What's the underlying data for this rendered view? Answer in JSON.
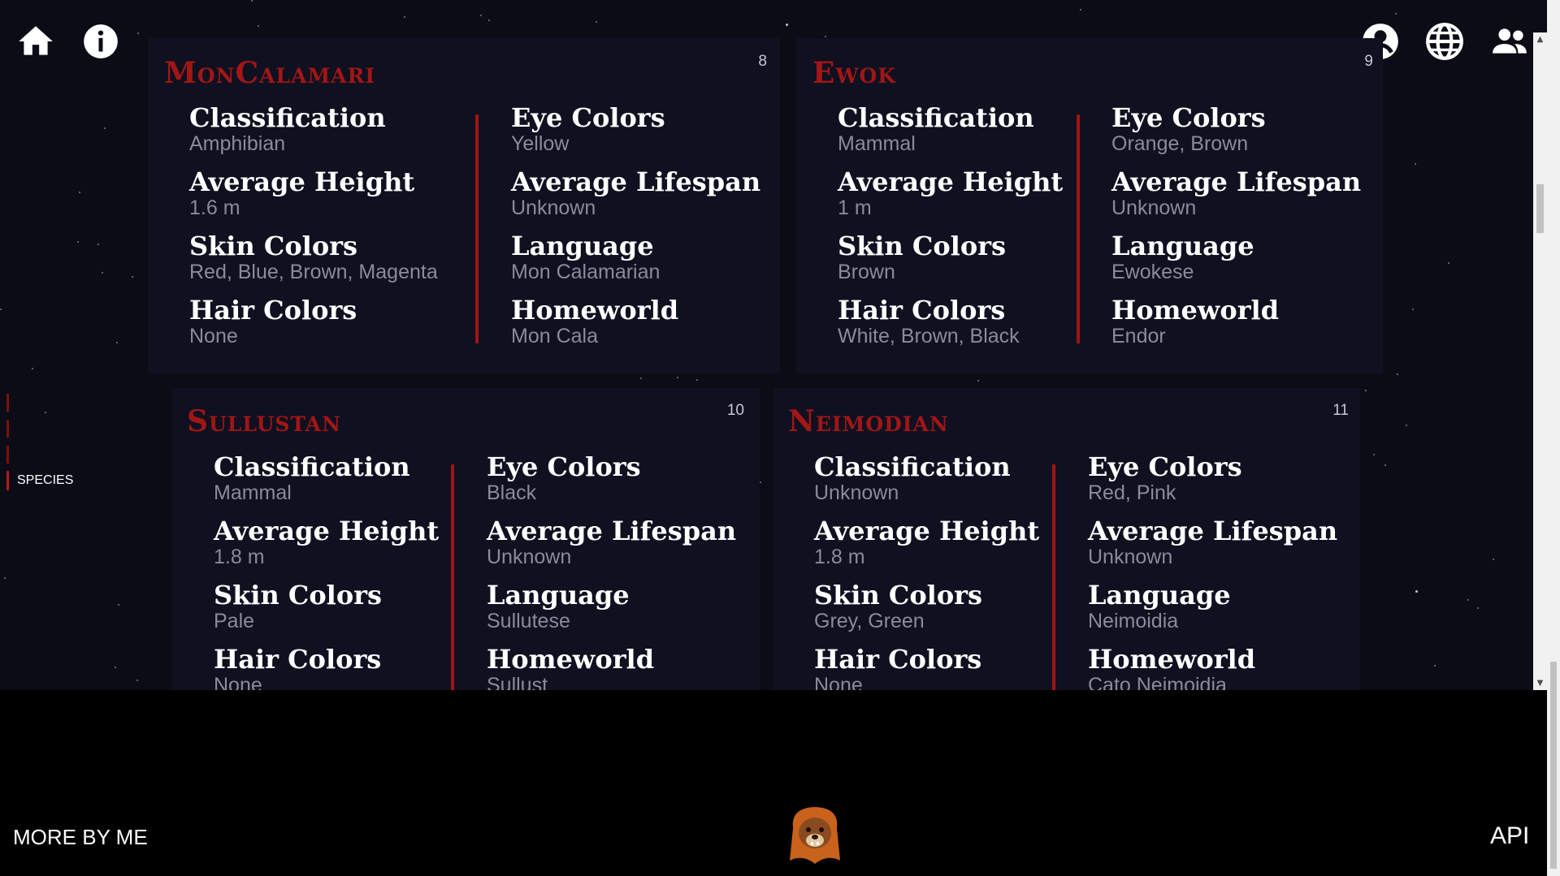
{
  "top_nav": {
    "left_icons": [
      "home-icon",
      "info-icon"
    ],
    "right_icons": [
      "user-icon",
      "globe-icon",
      "group-icon"
    ]
  },
  "cards": [
    {
      "name": "MonCalamari",
      "number": "8",
      "fields_left": [
        {
          "label": "Classification",
          "value": "Amphibian"
        },
        {
          "label": "Average Height",
          "value": "1.6 m"
        },
        {
          "label": "Skin Colors",
          "value": "Red, Blue, Brown, Magenta"
        },
        {
          "label": "Hair Colors",
          "value": "None"
        }
      ],
      "fields_right": [
        {
          "label": "Eye Colors",
          "value": "Yellow"
        },
        {
          "label": "Average Lifespan",
          "value": "Unknown"
        },
        {
          "label": "Language",
          "value": "Mon Calamarian"
        },
        {
          "label": "Homeworld",
          "value": "Mon Cala"
        }
      ]
    },
    {
      "name": "Ewok",
      "number": "9",
      "fields_left": [
        {
          "label": "Classification",
          "value": "Mammal"
        },
        {
          "label": "Average Height",
          "value": "1 m"
        },
        {
          "label": "Skin Colors",
          "value": "Brown"
        },
        {
          "label": "Hair Colors",
          "value": "White, Brown, Black"
        }
      ],
      "fields_right": [
        {
          "label": "Eye Colors",
          "value": "Orange, Brown"
        },
        {
          "label": "Average Lifespan",
          "value": "Unknown"
        },
        {
          "label": "Language",
          "value": "Ewokese"
        },
        {
          "label": "Homeworld",
          "value": "Endor"
        }
      ]
    },
    {
      "name": "Sullustan",
      "number": "10",
      "fields_left": [
        {
          "label": "Classification",
          "value": "Mammal"
        },
        {
          "label": "Average Height",
          "value": "1.8 m"
        },
        {
          "label": "Skin Colors",
          "value": "Pale"
        },
        {
          "label": "Hair Colors",
          "value": "None"
        }
      ],
      "fields_right": [
        {
          "label": "Eye Colors",
          "value": "Black"
        },
        {
          "label": "Average Lifespan",
          "value": "Unknown"
        },
        {
          "label": "Language",
          "value": "Sullutese"
        },
        {
          "label": "Homeworld",
          "value": "Sullust"
        }
      ]
    },
    {
      "name": "Neimodian",
      "number": "11",
      "fields_left": [
        {
          "label": "Classification",
          "value": "Unknown"
        },
        {
          "label": "Average Height",
          "value": "1.8 m"
        },
        {
          "label": "Skin Colors",
          "value": "Grey, Green"
        },
        {
          "label": "Hair Colors",
          "value": "None"
        }
      ],
      "fields_right": [
        {
          "label": "Eye Colors",
          "value": "Red, Pink"
        },
        {
          "label": "Average Lifespan",
          "value": "Unknown"
        },
        {
          "label": "Language",
          "value": "Neimoidia"
        },
        {
          "label": "Homeworld",
          "value": "Cato Neimoidia"
        }
      ]
    }
  ],
  "sidenav": {
    "active_label": "SPECIES"
  },
  "footer": {
    "left_link": "MORE BY ME",
    "right_link": "API",
    "mascot": "ewok-mascot-icon"
  },
  "colors": {
    "accent": "#a11616",
    "card_bg": "#0f1020",
    "muted_text": "#8a8c96"
  }
}
